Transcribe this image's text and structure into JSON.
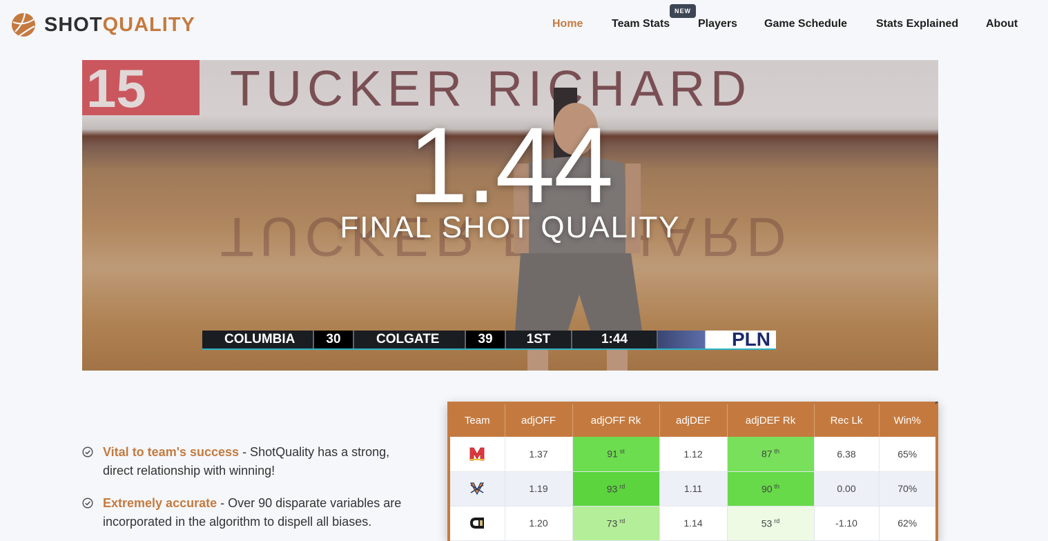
{
  "brand": {
    "logo_icon": "basketball-icon",
    "name_part1": "SHOT",
    "name_part2": "QUALITY",
    "accent": "#c47a3f",
    "dark": "#2f2f2f"
  },
  "nav": {
    "items": [
      {
        "label": "Home",
        "active": true
      },
      {
        "label": "Team Stats",
        "active": false
      },
      {
        "label": "Players",
        "active": false
      },
      {
        "label": "Game Schedule",
        "active": false
      },
      {
        "label": "Stats Explained",
        "active": false
      },
      {
        "label": "About",
        "active": false
      }
    ],
    "new_badge": "NEW"
  },
  "hero": {
    "value": "1.44",
    "label": "FINAL SHOT QUALITY",
    "banner_number": "15",
    "banner_text": "TUCKER RICHARD",
    "scoreboard": {
      "team1": "COLUMBIA",
      "score1": "30",
      "team2": "COLGATE",
      "score2": "39",
      "period": "1ST",
      "clock": "1:44",
      "network": "PLN"
    }
  },
  "features": [
    {
      "title": "Vital to team's success",
      "text": " - ShotQuality has a strong, direct relationship with winning!",
      "icon": "check-circle-icon"
    },
    {
      "title": "Extremely accurate",
      "text": " - Over 90 disparate variables are incorporated in the algorithm to dispell all biases.",
      "icon": "check-circle-icon"
    }
  ],
  "table": {
    "headers": [
      "Team",
      "adjOFF",
      "adjOFF Rk",
      "adjDEF",
      "adjDEF Rk",
      "Rec Lk",
      "Win%"
    ],
    "rows": [
      {
        "logo": "maryland-logo-icon",
        "adjOFF": "1.37",
        "adjOFF_rk": "91",
        "adjOFF_rk_suffix": "st",
        "adjOFF_rk_color": "#6cdd4e",
        "adjDEF": "1.12",
        "adjDEF_rk": "87",
        "adjDEF_rk_suffix": "th",
        "adjDEF_rk_color": "#78e05b",
        "rec_lk": "6.38",
        "win": "65%"
      },
      {
        "logo": "virginia-logo-icon",
        "adjOFF": "1.19",
        "adjOFF_rk": "93",
        "adjOFF_rk_suffix": "rd",
        "adjOFF_rk_color": "#5bd43e",
        "adjDEF": "1.11",
        "adjDEF_rk": "90",
        "adjDEF_rk_suffix": "th",
        "adjDEF_rk_color": "#66da48",
        "rec_lk": "0.00",
        "win": "70%"
      },
      {
        "logo": "colorado-logo-icon",
        "adjOFF": "1.20",
        "adjOFF_rk": "73",
        "adjOFF_rk_suffix": "rd",
        "adjOFF_rk_color": "#b5ee99",
        "adjDEF": "1.14",
        "adjDEF_rk": "53",
        "adjDEF_rk_suffix": "rd",
        "adjDEF_rk_color": "#eefae4",
        "rec_lk": "-1.10",
        "win": "62%"
      }
    ]
  }
}
